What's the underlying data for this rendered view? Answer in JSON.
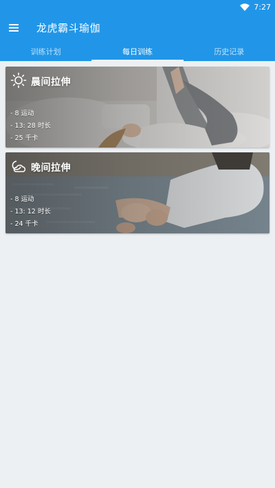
{
  "status_bar": {
    "time": "7:27",
    "icons": [
      "wifi-icon",
      "battery-icon"
    ]
  },
  "app_bar": {
    "title": "龙虎霸斗瑜伽",
    "menu_icon": "menu-icon"
  },
  "tabs": [
    {
      "label": "训练计划",
      "active": false
    },
    {
      "label": "每日训练",
      "active": true
    },
    {
      "label": "历史记录",
      "active": false
    }
  ],
  "workouts": [
    {
      "icon": "sun-icon",
      "title": "晨间拉伸",
      "stats": [
        "- 8 运动",
        "- 13: 28 时长",
        "- 25 千卡"
      ]
    },
    {
      "icon": "moon-cloud-icon",
      "title": "晚间拉伸",
      "stats": [
        "- 8 运动",
        "- 13: 12 时长",
        "- 24 千卡"
      ]
    }
  ],
  "colors": {
    "primary": "#2196e8",
    "background": "#ecf0f3"
  }
}
